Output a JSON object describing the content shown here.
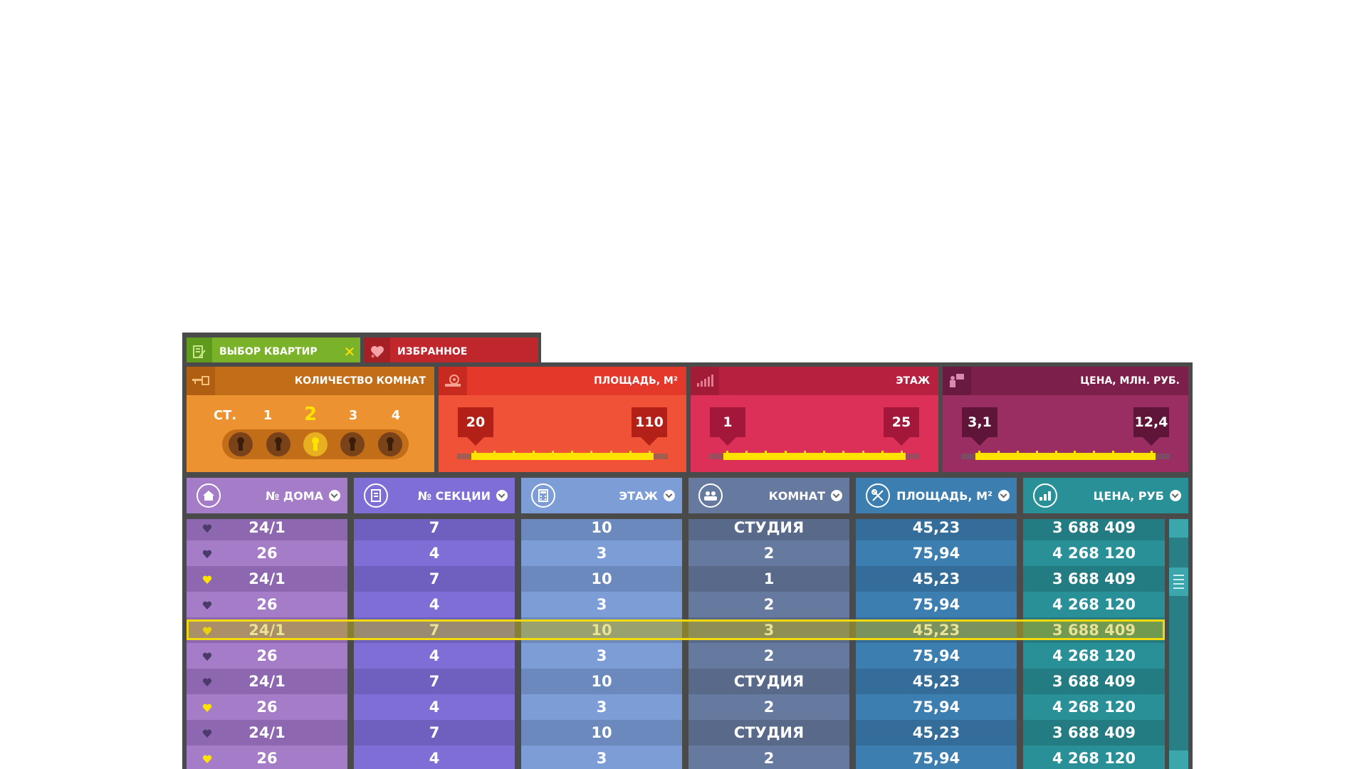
{
  "tabs": [
    {
      "label": "ВЫБОР КВАРТИР",
      "icon": "list-edit-icon",
      "close": "✕",
      "color": "#7ab22a"
    },
    {
      "label": "ИЗБРАННОЕ",
      "icon": "heart-plus-icon",
      "color": "#c0272d"
    }
  ],
  "filters": {
    "rooms": {
      "title": "КОЛИЧЕСТВО КОМНАТ",
      "icon": "key-icon",
      "options": [
        "СТ.",
        "1",
        "2",
        "3",
        "4"
      ],
      "selected": "2"
    },
    "area": {
      "title": "ПЛОЩАДЬ, М²",
      "icon": "tape-measure-icon",
      "min": "20",
      "max": "110"
    },
    "floor": {
      "title": "ЭТАЖ",
      "icon": "signal-bars-icon",
      "min": "1",
      "max": "25"
    },
    "price": {
      "title": "ЦЕНА, МЛН. РУБ.",
      "icon": "price-tags-icon",
      "min": "3,1",
      "max": "12,4"
    }
  },
  "table": {
    "columns": [
      {
        "label": "№ ДОМА",
        "icon": "house-icon"
      },
      {
        "label": "№ СЕКЦИИ",
        "icon": "document-icon"
      },
      {
        "label": "ЭТАЖ",
        "icon": "calculator-icon"
      },
      {
        "label": "КОМНАТ",
        "icon": "people-icon"
      },
      {
        "label": "ПЛОЩАДЬ, М²",
        "icon": "tools-icon"
      },
      {
        "label": "ЦЕНА, РУБ",
        "icon": "stacked-coins-icon"
      }
    ],
    "rows": [
      {
        "fav": false,
        "house": "24/1",
        "section": "7",
        "floor": "10",
        "rooms": "СТУДИЯ",
        "area": "45,23",
        "price": "3 688 409"
      },
      {
        "fav": false,
        "house": "26",
        "section": "4",
        "floor": "3",
        "rooms": "2",
        "area": "75,94",
        "price": "4 268 120"
      },
      {
        "fav": true,
        "house": "24/1",
        "section": "7",
        "floor": "10",
        "rooms": "1",
        "area": "45,23",
        "price": "3 688 409"
      },
      {
        "fav": false,
        "house": "26",
        "section": "4",
        "floor": "3",
        "rooms": "2",
        "area": "75,94",
        "price": "4 268 120"
      },
      {
        "fav": true,
        "house": "24/1",
        "section": "7",
        "floor": "10",
        "rooms": "3",
        "area": "45,23",
        "price": "3 688 409",
        "highlighted": true
      },
      {
        "fav": false,
        "house": "26",
        "section": "4",
        "floor": "3",
        "rooms": "2",
        "area": "75,94",
        "price": "4 268 120"
      },
      {
        "fav": false,
        "house": "24/1",
        "section": "7",
        "floor": "10",
        "rooms": "СТУДИЯ",
        "area": "45,23",
        "price": "3 688 409"
      },
      {
        "fav": true,
        "house": "26",
        "section": "4",
        "floor": "3",
        "rooms": "2",
        "area": "75,94",
        "price": "4 268 120"
      },
      {
        "fav": false,
        "house": "24/1",
        "section": "7",
        "floor": "10",
        "rooms": "СТУДИЯ",
        "area": "45,23",
        "price": "3 688 409"
      },
      {
        "fav": true,
        "house": "26",
        "section": "4",
        "floor": "3",
        "rooms": "2",
        "area": "75,94",
        "price": "4 268 120"
      }
    ]
  },
  "colors": {
    "rooms_head": "#c26d18",
    "rooms_body": "#ec9231",
    "area_head": "#e3382a",
    "area_body": "#f05238",
    "floor_head": "#b8203f",
    "floor_body": "#dc3058",
    "price_head": "#7d1f4b",
    "price_body": "#9a2e63",
    "col_house": "#a57cc8",
    "col_section": "#7f6ed6",
    "col_floor": "#7d9dd6",
    "col_rooms": "#667aa0",
    "col_area": "#3d7eb1",
    "col_price": "#2a9098",
    "highlight": "#f1d90d",
    "heart_fav": "#ffe300"
  }
}
